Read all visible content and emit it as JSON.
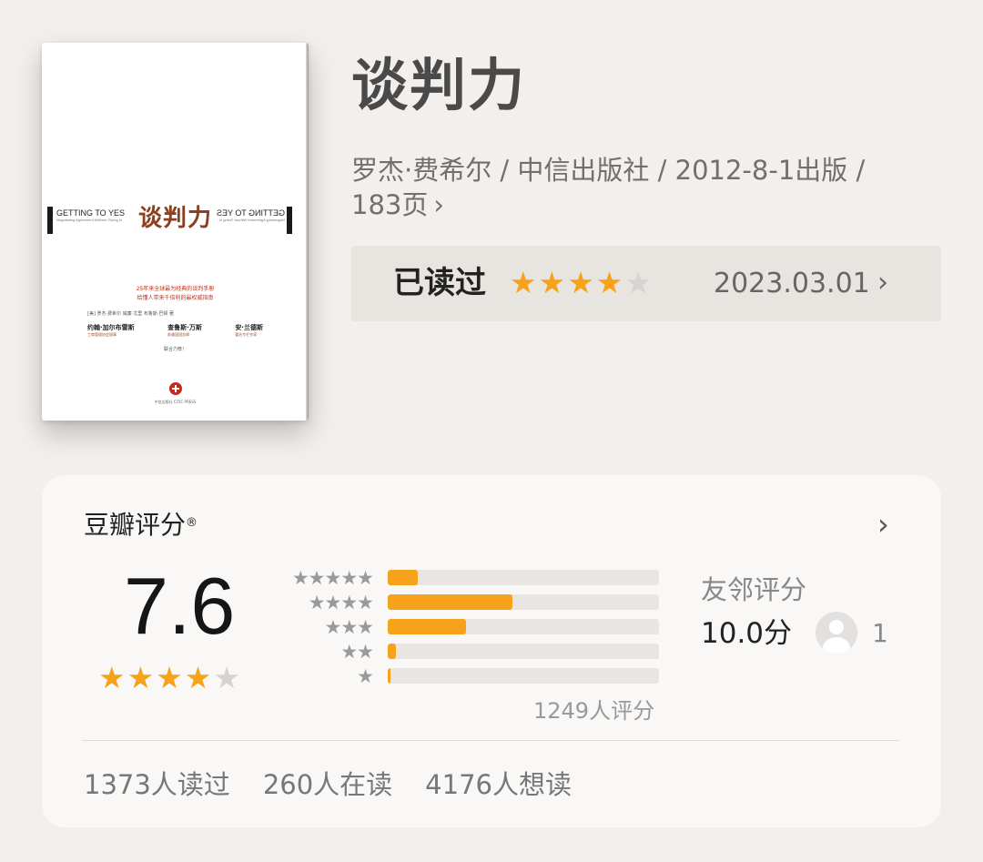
{
  "book": {
    "title": "谈判力",
    "meta_line1": "罗杰·费希尔 / 中信出版社 / 2012-8-1出版 /",
    "meta_line2": "183页",
    "more_chevron": "›"
  },
  "cover": {
    "title": "谈判力",
    "brand_left": "GETTING TO YES",
    "brand_left_sub": "Negotiating Agreement Without Giving In",
    "brand_right": "GETTING TO YES",
    "brand_right_sub": "Negotiating Agreement Without Giving In",
    "slogan_1": "25年来全球最为经典的谈判手册",
    "slogan_2": "给懂人带来千倍利的最权威指南",
    "authors_line": "[美] 罗杰·费希尔 威廉·尤里 布鲁斯·巴顿 著",
    "name_1": "约翰·加尔布雷斯",
    "name_1_sub": "工商管理协会理事",
    "name_2": "查鲁斯·万斯",
    "name_2_sub": "前美国国务卿",
    "name_3": "安·兰德斯",
    "name_3_sub": "著名专栏作家",
    "tagline": "联合力荐！",
    "publisher": "中信出版社 CITIC PRESS"
  },
  "read_status": {
    "label": "已读过",
    "rating": 4,
    "max_rating": 5,
    "date": "2023.03.01",
    "chevron": "›"
  },
  "rating_card": {
    "title": "豆瓣评分",
    "title_mark": "®",
    "chevron": "›",
    "score": "7.6",
    "score_stars": 4,
    "distribution": [
      {
        "stars": "★★★★★",
        "fraction": 0.11
      },
      {
        "stars": "★★★★",
        "fraction": 0.46
      },
      {
        "stars": "★★★",
        "fraction": 0.29
      },
      {
        "stars": "★★",
        "fraction": 0.03
      },
      {
        "stars": "★",
        "fraction": 0.005
      }
    ],
    "rating_count": "1249人评分",
    "friend_label": "友邻评分",
    "friend_score": "10.0分",
    "friend_count": "1",
    "stats": [
      "1373人读过",
      "260人在读",
      "4176人想读"
    ]
  },
  "icons": {
    "star_on": "star-icon",
    "star_off": "star-empty-icon",
    "chevron": "chevron-right-icon",
    "avatar": "avatar-icon"
  },
  "colors": {
    "accent": "#f7a21b",
    "star_off": "#d6d3d0",
    "background": "#f2efec",
    "card": "#faf8f6"
  }
}
